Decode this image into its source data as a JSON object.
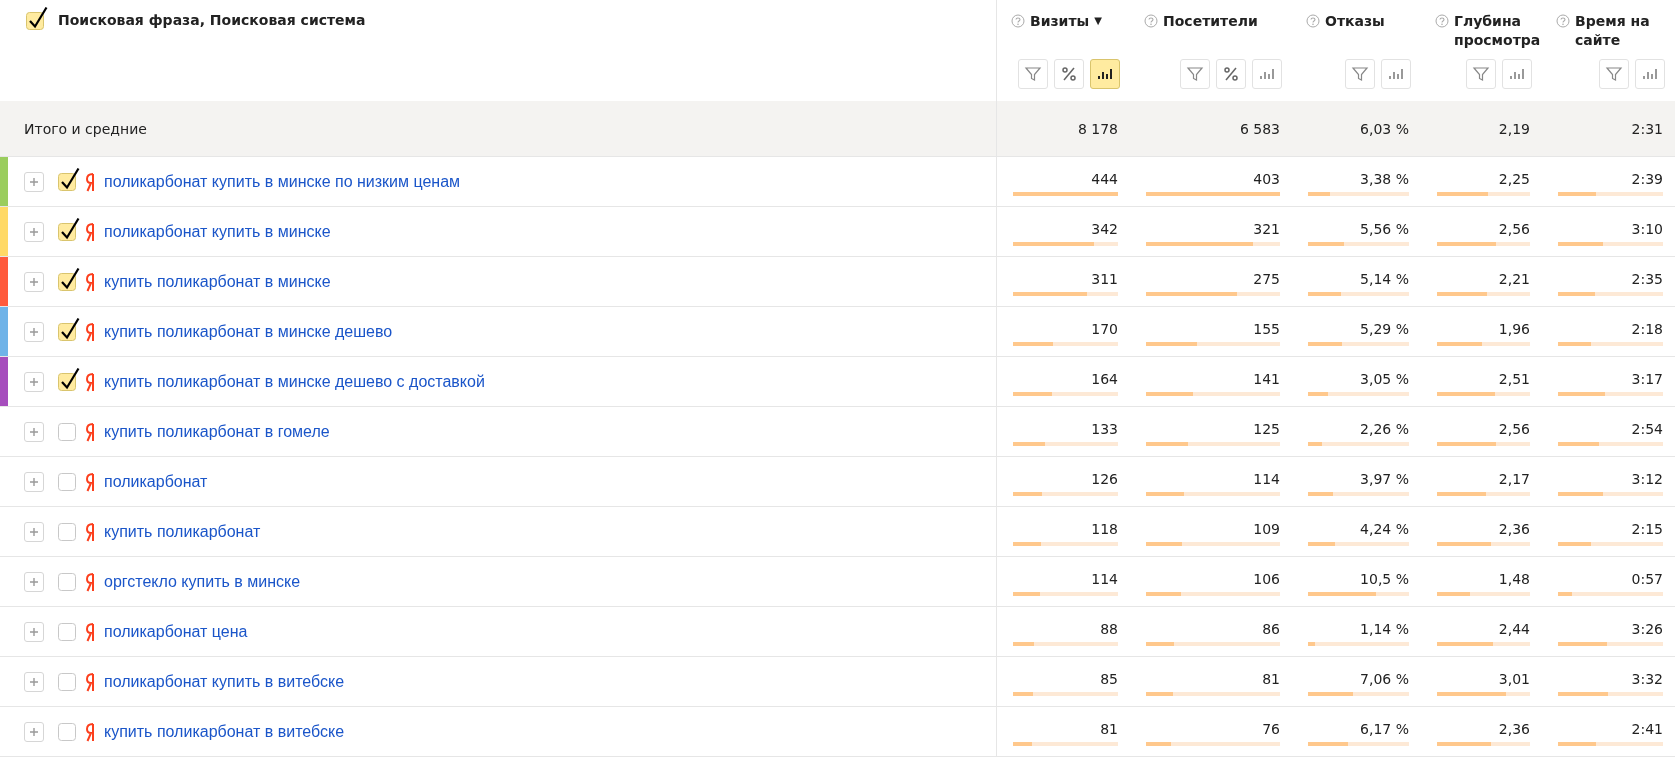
{
  "header": {
    "checked": true,
    "title": "Поисковая фраза, Поисковая система"
  },
  "columns": [
    {
      "title": "Визиты",
      "sort": "▼",
      "buttons": [
        {
          "kind": "filter",
          "selected": false
        },
        {
          "kind": "percent",
          "selected": false
        },
        {
          "kind": "chart",
          "selected": true
        }
      ]
    },
    {
      "title": "Посетители",
      "buttons": [
        {
          "kind": "filter",
          "selected": false
        },
        {
          "kind": "percent",
          "selected": false
        },
        {
          "kind": "chart",
          "selected": false
        }
      ]
    },
    {
      "title": "Отказы",
      "buttons": [
        {
          "kind": "filter",
          "selected": false
        },
        {
          "kind": "chart",
          "selected": false
        }
      ]
    },
    {
      "title": "Глубина просмотра",
      "buttons": [
        {
          "kind": "filter",
          "selected": false
        },
        {
          "kind": "chart",
          "selected": false
        }
      ]
    },
    {
      "title": "Время на сайте",
      "buttons": [
        {
          "kind": "filter",
          "selected": false
        },
        {
          "kind": "chart",
          "selected": false
        }
      ]
    }
  ],
  "totals": {
    "label": "Итого и средние",
    "values": [
      "8 178",
      "6 583",
      "6,03 %",
      "2,19",
      "2:31"
    ]
  },
  "rows": [
    {
      "color": "#9acd5e",
      "checked": true,
      "phrase": "поликарбонат купить в минске по низким ценам",
      "cells": [
        {
          "value": "444",
          "level": 1.0
        },
        {
          "value": "403",
          "level": 1.0
        },
        {
          "value": "3,38 %",
          "level": 0.22
        },
        {
          "value": "2,25",
          "level": 0.55
        },
        {
          "value": "2:39",
          "level": 0.36
        }
      ]
    },
    {
      "color": "#ffd966",
      "checked": true,
      "phrase": "поликарбонат купить в минске",
      "cells": [
        {
          "value": "342",
          "level": 0.77
        },
        {
          "value": "321",
          "level": 0.8
        },
        {
          "value": "5,56 %",
          "level": 0.36
        },
        {
          "value": "2,56",
          "level": 0.63
        },
        {
          "value": "3:10",
          "level": 0.43
        }
      ]
    },
    {
      "color": "#ff5a3c",
      "checked": true,
      "phrase": "купить поликарбонат в минске",
      "cells": [
        {
          "value": "311",
          "level": 0.7
        },
        {
          "value": "275",
          "level": 0.68
        },
        {
          "value": "5,14 %",
          "level": 0.33
        },
        {
          "value": "2,21",
          "level": 0.54
        },
        {
          "value": "2:35",
          "level": 0.35
        }
      ]
    },
    {
      "color": "#6fb3e8",
      "checked": true,
      "phrase": "купить поликарбонат в минске дешево",
      "cells": [
        {
          "value": "170",
          "level": 0.38
        },
        {
          "value": "155",
          "level": 0.38
        },
        {
          "value": "5,29 %",
          "level": 0.34
        },
        {
          "value": "1,96",
          "level": 0.48
        },
        {
          "value": "2:18",
          "level": 0.31
        }
      ]
    },
    {
      "color": "#a64dbd",
      "checked": true,
      "phrase": "купить поликарбонат в минске дешево с доставкой",
      "cells": [
        {
          "value": "164",
          "level": 0.37
        },
        {
          "value": "141",
          "level": 0.35
        },
        {
          "value": "3,05 %",
          "level": 0.2
        },
        {
          "value": "2,51",
          "level": 0.62
        },
        {
          "value": "3:17",
          "level": 0.45
        }
      ]
    },
    {
      "checked": false,
      "phrase": "купить поликарбонат в гомеле",
      "cells": [
        {
          "value": "133",
          "level": 0.3
        },
        {
          "value": "125",
          "level": 0.31
        },
        {
          "value": "2,26 %",
          "level": 0.14
        },
        {
          "value": "2,56",
          "level": 0.63
        },
        {
          "value": "2:54",
          "level": 0.39
        }
      ]
    },
    {
      "checked": false,
      "phrase": "поликарбонат",
      "cells": [
        {
          "value": "126",
          "level": 0.28
        },
        {
          "value": "114",
          "level": 0.28
        },
        {
          "value": "3,97 %",
          "level": 0.25
        },
        {
          "value": "2,17",
          "level": 0.53
        },
        {
          "value": "3:12",
          "level": 0.43
        }
      ]
    },
    {
      "checked": false,
      "phrase": "купить поликарбонат",
      "cells": [
        {
          "value": "118",
          "level": 0.27
        },
        {
          "value": "109",
          "level": 0.27
        },
        {
          "value": "4,24 %",
          "level": 0.27
        },
        {
          "value": "2,36",
          "level": 0.58
        },
        {
          "value": "2:15",
          "level": 0.31
        }
      ]
    },
    {
      "checked": false,
      "phrase": "оргстекло купить в минске",
      "cells": [
        {
          "value": "114",
          "level": 0.26
        },
        {
          "value": "106",
          "level": 0.26
        },
        {
          "value": "10,5 %",
          "level": 0.67
        },
        {
          "value": "1,48",
          "level": 0.36
        },
        {
          "value": "0:57",
          "level": 0.13
        }
      ]
    },
    {
      "checked": false,
      "phrase": "поликарбонат цена",
      "cells": [
        {
          "value": "88",
          "level": 0.2
        },
        {
          "value": "86",
          "level": 0.21
        },
        {
          "value": "1,14 %",
          "level": 0.07
        },
        {
          "value": "2,44",
          "level": 0.6
        },
        {
          "value": "3:26",
          "level": 0.47
        }
      ]
    },
    {
      "checked": false,
      "phrase": "поликарбонат купить в витебске",
      "cells": [
        {
          "value": "85",
          "level": 0.19
        },
        {
          "value": "81",
          "level": 0.2
        },
        {
          "value": "7,06 %",
          "level": 0.45
        },
        {
          "value": "3,01",
          "level": 0.74
        },
        {
          "value": "3:32",
          "level": 0.48
        }
      ]
    },
    {
      "checked": false,
      "phrase": "купить поликарбонат в витебске",
      "cells": [
        {
          "value": "81",
          "level": 0.18
        },
        {
          "value": "76",
          "level": 0.19
        },
        {
          "value": "6,17 %",
          "level": 0.4
        },
        {
          "value": "2,36",
          "level": 0.58
        },
        {
          "value": "2:41",
          "level": 0.36
        }
      ]
    }
  ]
}
